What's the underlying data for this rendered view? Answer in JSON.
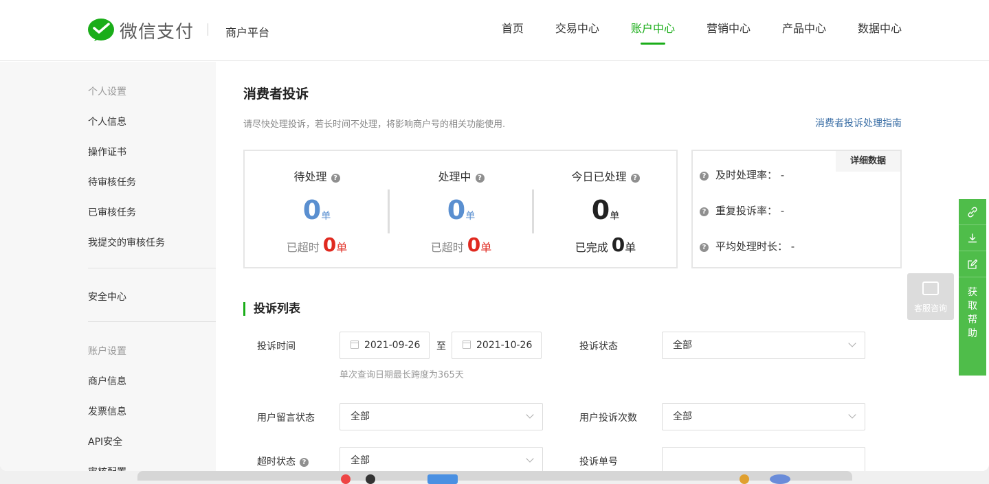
{
  "header": {
    "logo_text": "微信支付",
    "platform": "商户平台",
    "nav": [
      "首页",
      "交易中心",
      "账户中心",
      "营销中心",
      "产品中心",
      "数据中心"
    ],
    "active_nav": "账户中心",
    "brand_color": "#1aad19"
  },
  "sidebar": {
    "group_personal": "个人设置",
    "personal_items": [
      "个人信息",
      "操作证书",
      "待审核任务",
      "已审核任务",
      "我提交的审核任务"
    ],
    "security": "安全中心",
    "group_account": "账户设置",
    "account_items": [
      "商户信息",
      "发票信息",
      "API安全",
      "审核配置"
    ]
  },
  "main": {
    "title": "消费者投诉",
    "desc": "请尽快处理投诉，若长时间不处理，将影响商户号的相关功能使用.",
    "guide_link": "消费者投诉处理指南",
    "stats": [
      {
        "label": "待处理",
        "value": "0",
        "unit": "单",
        "sub_label": "已超时",
        "sub_value": "0",
        "sub_unit": "单"
      },
      {
        "label": "处理中",
        "value": "0",
        "unit": "单",
        "sub_label": "已超时",
        "sub_value": "0",
        "sub_unit": "单"
      },
      {
        "label": "今日已处理",
        "value": "0",
        "unit": "单",
        "sub_label": "已完成",
        "sub_value": "0",
        "sub_unit": "单"
      }
    ],
    "rates": {
      "detail_button": "详细数据",
      "items": [
        {
          "label": "及时处理率：",
          "value": "-"
        },
        {
          "label": "重复投诉率：",
          "value": "-"
        },
        {
          "label": "平均处理时长：",
          "value": "-"
        }
      ]
    },
    "list_title": "投诉列表",
    "form": {
      "time_label": "投诉时间",
      "date_from": "2021-09-26",
      "date_to_sep": "至",
      "date_to": "2021-10-26",
      "date_hint": "单次查询日期最长跨度为365天",
      "status_label": "投诉状态",
      "status_value": "全部",
      "msg_status_label": "用户留言状态",
      "msg_status_value": "全部",
      "count_label": "用户投诉次数",
      "count_value": "全部",
      "timeout_label": "超时状态",
      "timeout_value": "全部",
      "order_label": "投诉单号",
      "order_value": ""
    }
  },
  "float": {
    "help_text": "获取帮助",
    "cs_text": "客服咨询"
  }
}
